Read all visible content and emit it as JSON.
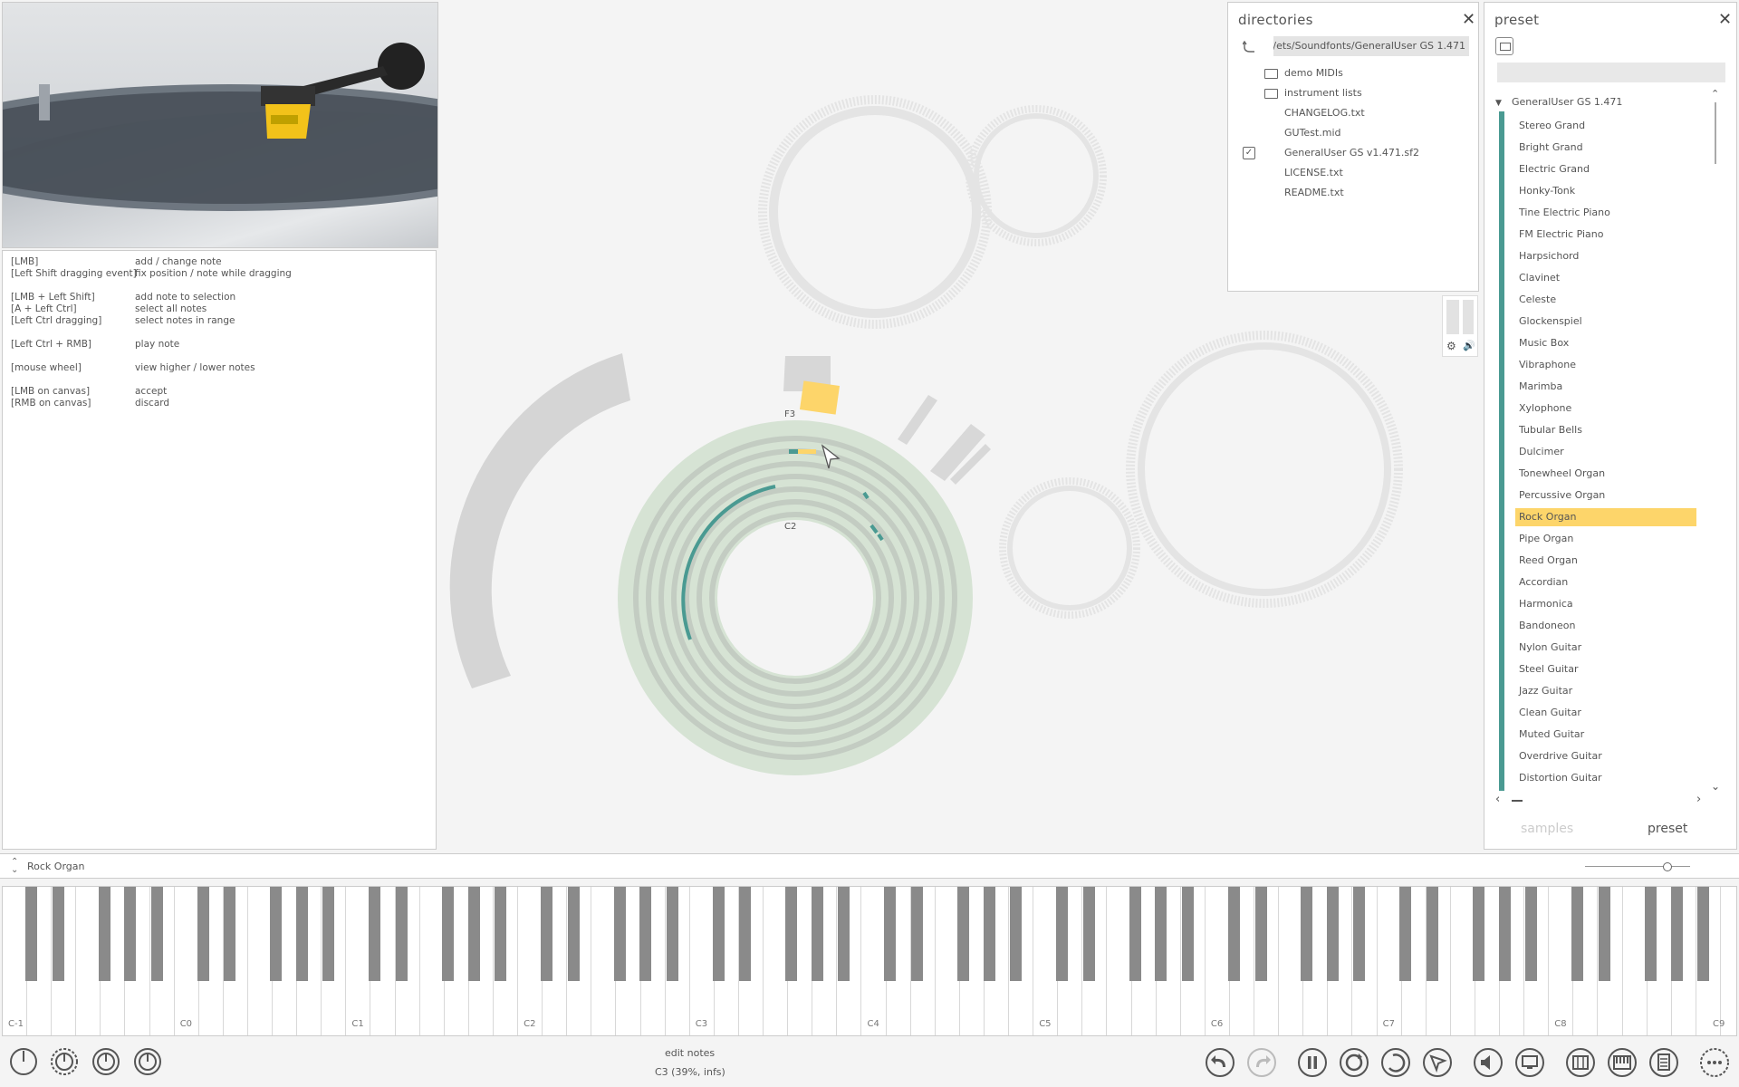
{
  "shortcuts": [
    {
      "key": "[LMB]",
      "desc": "add / change note"
    },
    {
      "key": "[Left Shift dragging event]",
      "desc": "fix position / note while dragging"
    },
    null,
    {
      "key": "[LMB + Left Shift]",
      "desc": "add note to selection"
    },
    {
      "key": "[A + Left Ctrl]",
      "desc": "select all notes"
    },
    {
      "key": "[Left Ctrl dragging]",
      "desc": "select notes in range"
    },
    null,
    {
      "key": "[Left Ctrl + RMB]",
      "desc": "play note"
    },
    null,
    {
      "key": "[mouse wheel]",
      "desc": "view higher / lower notes"
    },
    null,
    {
      "key": "[LMB on canvas]",
      "desc": "accept"
    },
    {
      "key": "[RMB on canvas]",
      "desc": "discard"
    }
  ],
  "directories": {
    "title": "directories",
    "path": "ets/Soundfonts/GeneralUser GS 1.471/",
    "items": [
      {
        "name": "demo MIDIs",
        "type": "folder"
      },
      {
        "name": "instrument lists",
        "type": "folder"
      },
      {
        "name": "CHANGELOG.txt",
        "type": "file"
      },
      {
        "name": "GUTest.mid",
        "type": "file"
      },
      {
        "name": "GeneralUser GS v1.471.sf2",
        "type": "checked"
      },
      {
        "name": "LICENSE.txt",
        "type": "file"
      },
      {
        "name": "README.txt",
        "type": "file"
      }
    ]
  },
  "preset": {
    "title": "preset",
    "root": "GeneralUser GS 1.471",
    "items": [
      "Stereo Grand",
      "Bright Grand",
      "Electric Grand",
      "Honky-Tonk",
      "Tine Electric Piano",
      "FM Electric Piano",
      "Harpsichord",
      "Clavinet",
      "Celeste",
      "Glockenspiel",
      "Music Box",
      "Vibraphone",
      "Marimba",
      "Xylophone",
      "Tubular Bells",
      "Dulcimer",
      "Tonewheel Organ",
      "Percussive Organ",
      "Rock Organ",
      "Pipe Organ",
      "Reed Organ",
      "Accordian",
      "Harmonica",
      "Bandoneon",
      "Nylon Guitar",
      "Steel Guitar",
      "Jazz Guitar",
      "Clean Guitar",
      "Muted Guitar",
      "Overdrive Guitar",
      "Distortion Guitar"
    ],
    "selected": "Rock Organ",
    "tabs": {
      "samples": "samples",
      "preset": "preset"
    }
  },
  "canvas": {
    "label_top": "F3",
    "label_mid": "C2"
  },
  "instrument_bar": {
    "name": "Rock Organ"
  },
  "keyboard": {
    "octaves": [
      "C-1",
      "C0",
      "C1",
      "C2",
      "C3",
      "C4",
      "C5",
      "C6",
      "C7",
      "C8",
      "C9"
    ]
  },
  "status": {
    "mode": "edit notes",
    "note": "C3 (39%, infs)"
  },
  "colors": {
    "accent": "#4a9a92",
    "highlight": "#fdd56a",
    "disc": "#d6e3d4"
  }
}
